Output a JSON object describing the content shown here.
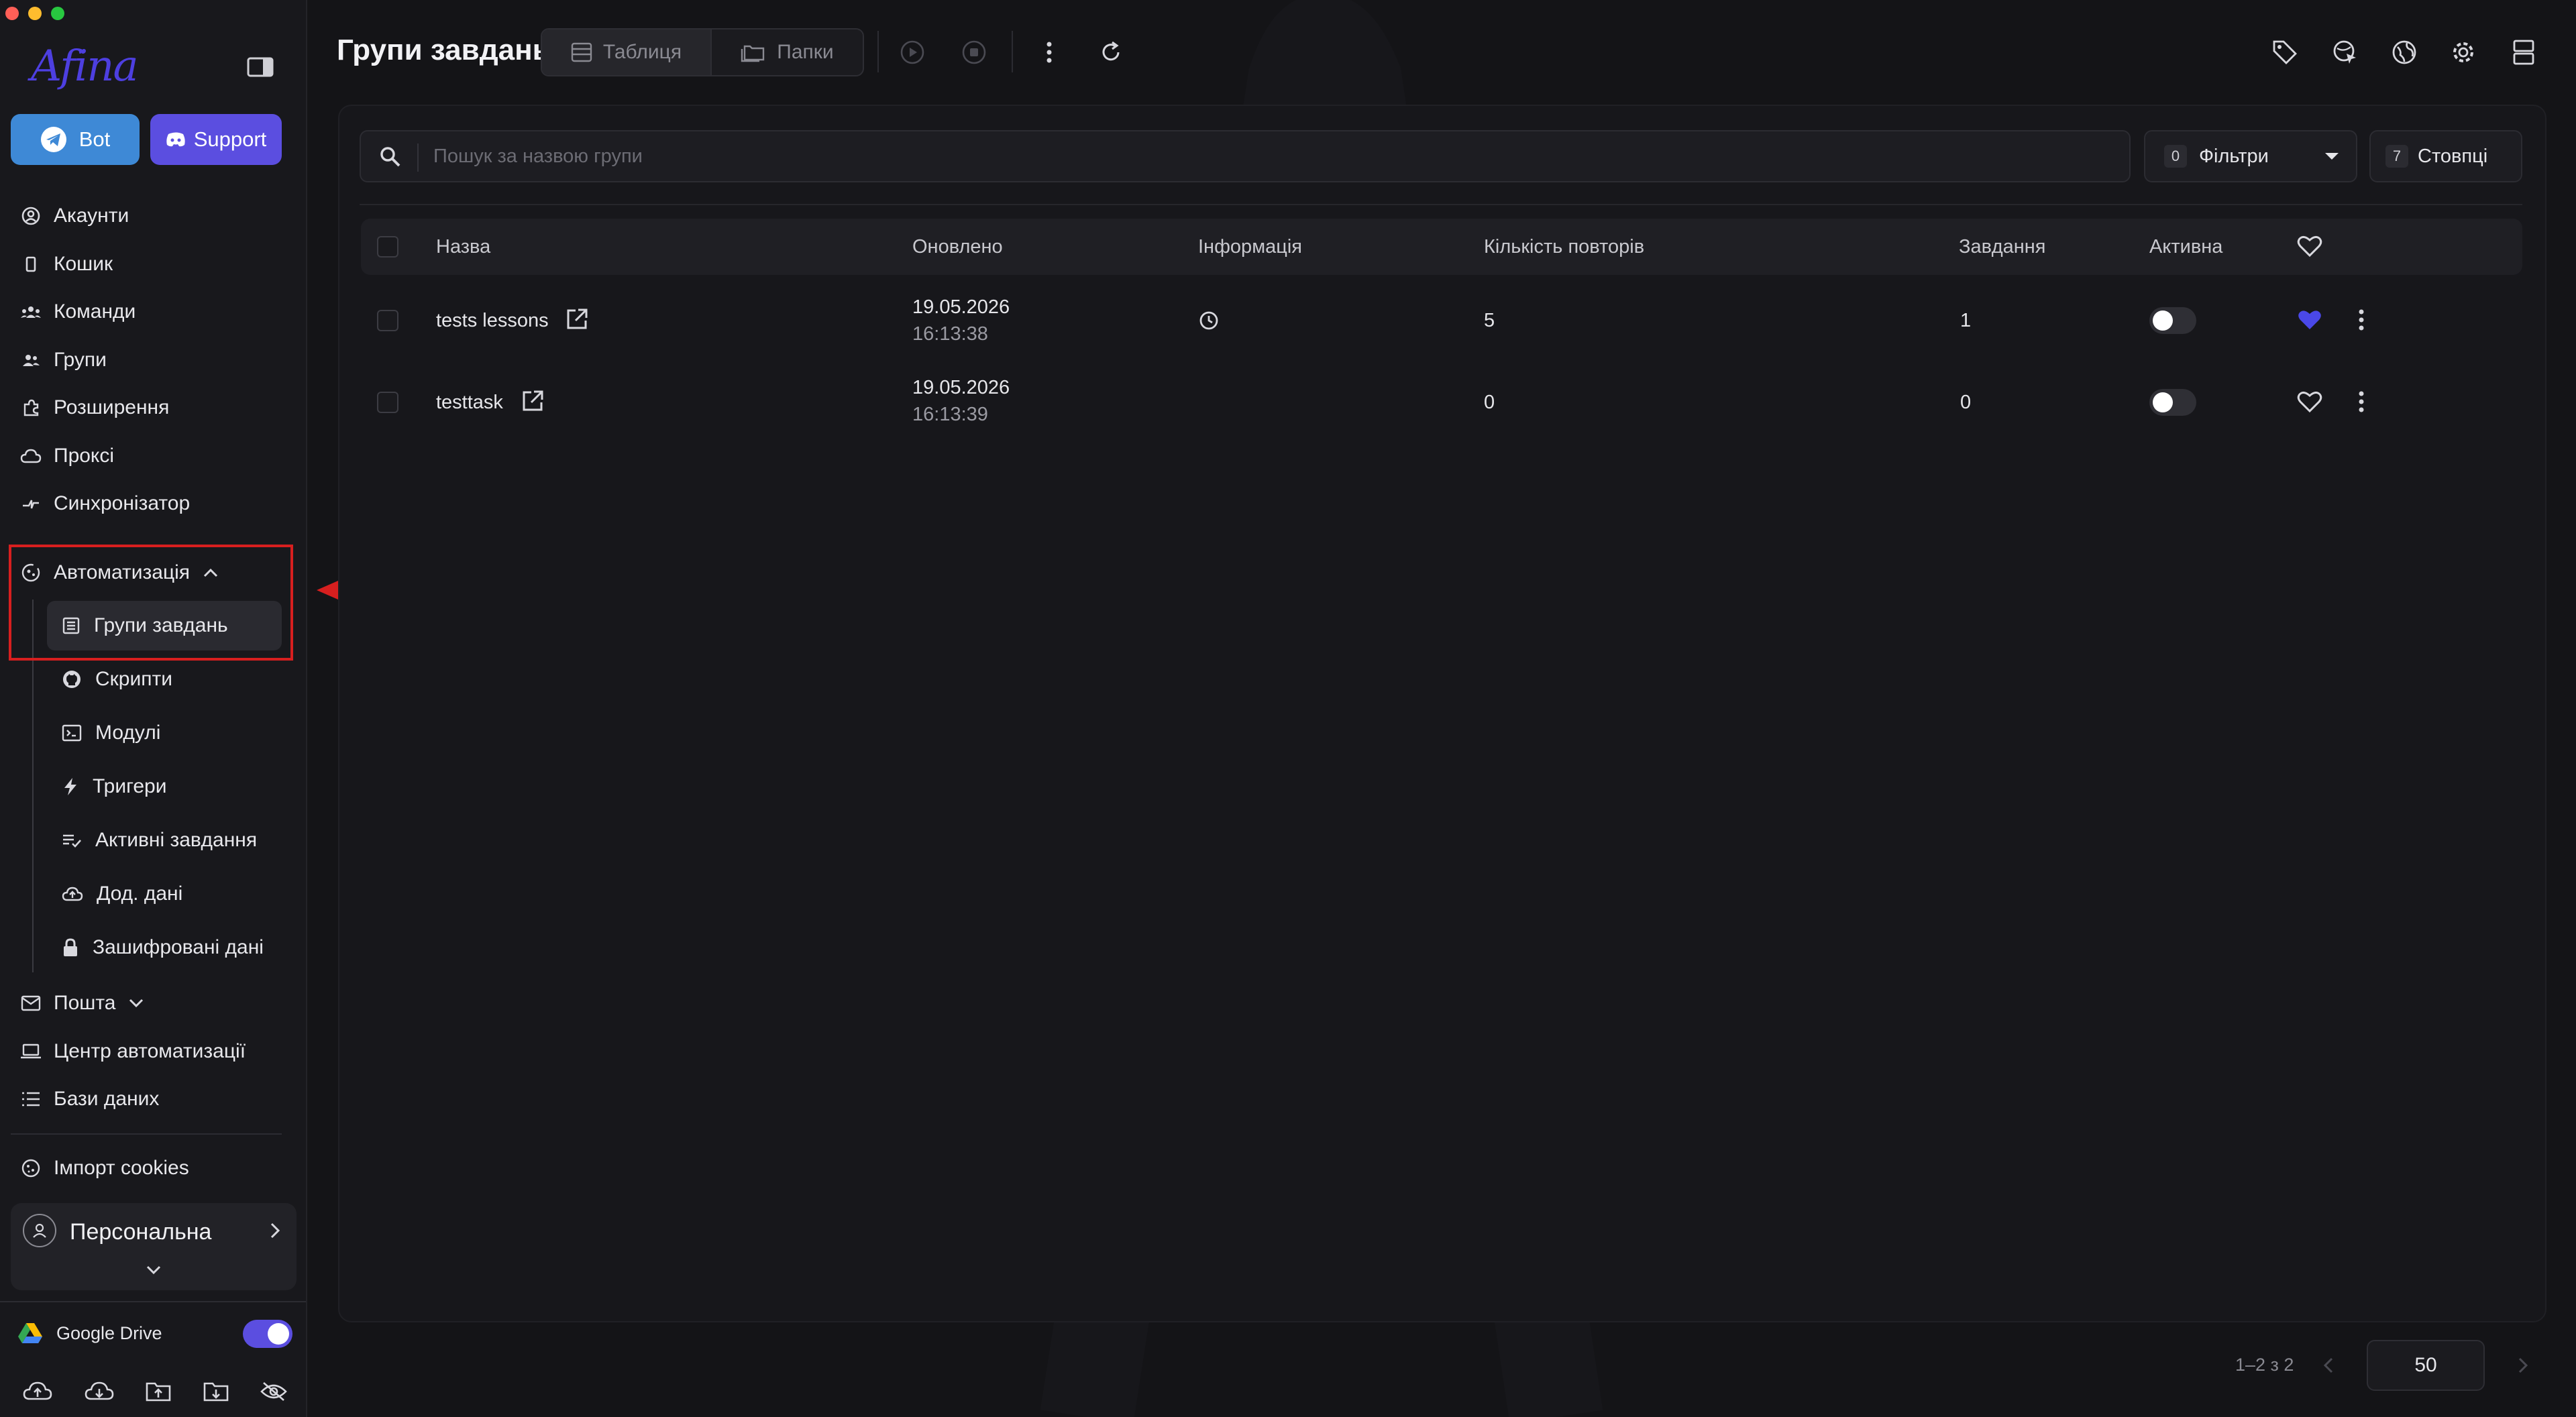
{
  "app": {
    "logo_text": "Afina"
  },
  "colors": {
    "accent": "#5b4ee0",
    "bot": "#3e89d6",
    "highlight": "#d71f1f",
    "heart_active": "#4a48e8"
  },
  "sidebar": {
    "bot_label": "Bot",
    "support_label": "Support",
    "items": [
      {
        "label": "Акаунти",
        "icon": "user-circle-icon"
      },
      {
        "label": "Кошик",
        "icon": "trash-icon"
      },
      {
        "label": "Команди",
        "icon": "team-icon"
      },
      {
        "label": "Групи",
        "icon": "users-icon"
      },
      {
        "label": "Розширення",
        "icon": "puzzle-icon"
      },
      {
        "label": "Проксі",
        "icon": "cloud-icon"
      },
      {
        "label": "Синхронізатор",
        "icon": "sync-icon"
      }
    ],
    "automation": {
      "label": "Автоматизація",
      "icon": "automation-icon",
      "children": [
        {
          "label": "Групи завдань",
          "icon": "task-list-icon",
          "active": true
        },
        {
          "label": "Скрипти",
          "icon": "github-icon"
        },
        {
          "label": "Модулі",
          "icon": "module-icon"
        },
        {
          "label": "Тригери",
          "icon": "bolt-icon"
        },
        {
          "label": "Активні завдання",
          "icon": "active-tasks-icon"
        },
        {
          "label": "Дод. дані",
          "icon": "cloud-upload-icon"
        },
        {
          "label": "Зашифровані дані",
          "icon": "lock-icon"
        }
      ]
    },
    "after_items": [
      {
        "label": "Пошта",
        "icon": "mail-icon",
        "expandable": true
      },
      {
        "label": "Центр автоматизації",
        "icon": "laptop-icon"
      },
      {
        "label": "Бази даних",
        "icon": "database-icon"
      }
    ],
    "import_cookies": "Імпорт cookies",
    "workspace": "Персональна",
    "gdrive_label": "Google Drive"
  },
  "toolbar": {
    "title": "Групи завдань",
    "view_table": "Таблиця",
    "view_folders": "Папки"
  },
  "filters": {
    "search_placeholder": "Пошук за назвою групи",
    "filters_count": "0",
    "filters_label": "Фільтри",
    "columns_count": "7",
    "columns_label": "Стовпці"
  },
  "table": {
    "headers": {
      "name": "Назва",
      "updated": "Оновлено",
      "info": "Інформація",
      "repeats": "Кількість повторів",
      "tasks": "Завдання",
      "active": "Активна"
    },
    "rows": [
      {
        "name": "tests lessons",
        "date": "19.05.2026",
        "time": "16:13:38",
        "has_schedule": true,
        "repeats": "5",
        "tasks": "1",
        "active": false,
        "favorite": true
      },
      {
        "name": "testtask",
        "date": "19.05.2026",
        "time": "16:13:39",
        "has_schedule": false,
        "repeats": "0",
        "tasks": "0",
        "active": false,
        "favorite": false
      }
    ]
  },
  "pagination": {
    "range": "1–2 з 2",
    "per_page": "50"
  }
}
